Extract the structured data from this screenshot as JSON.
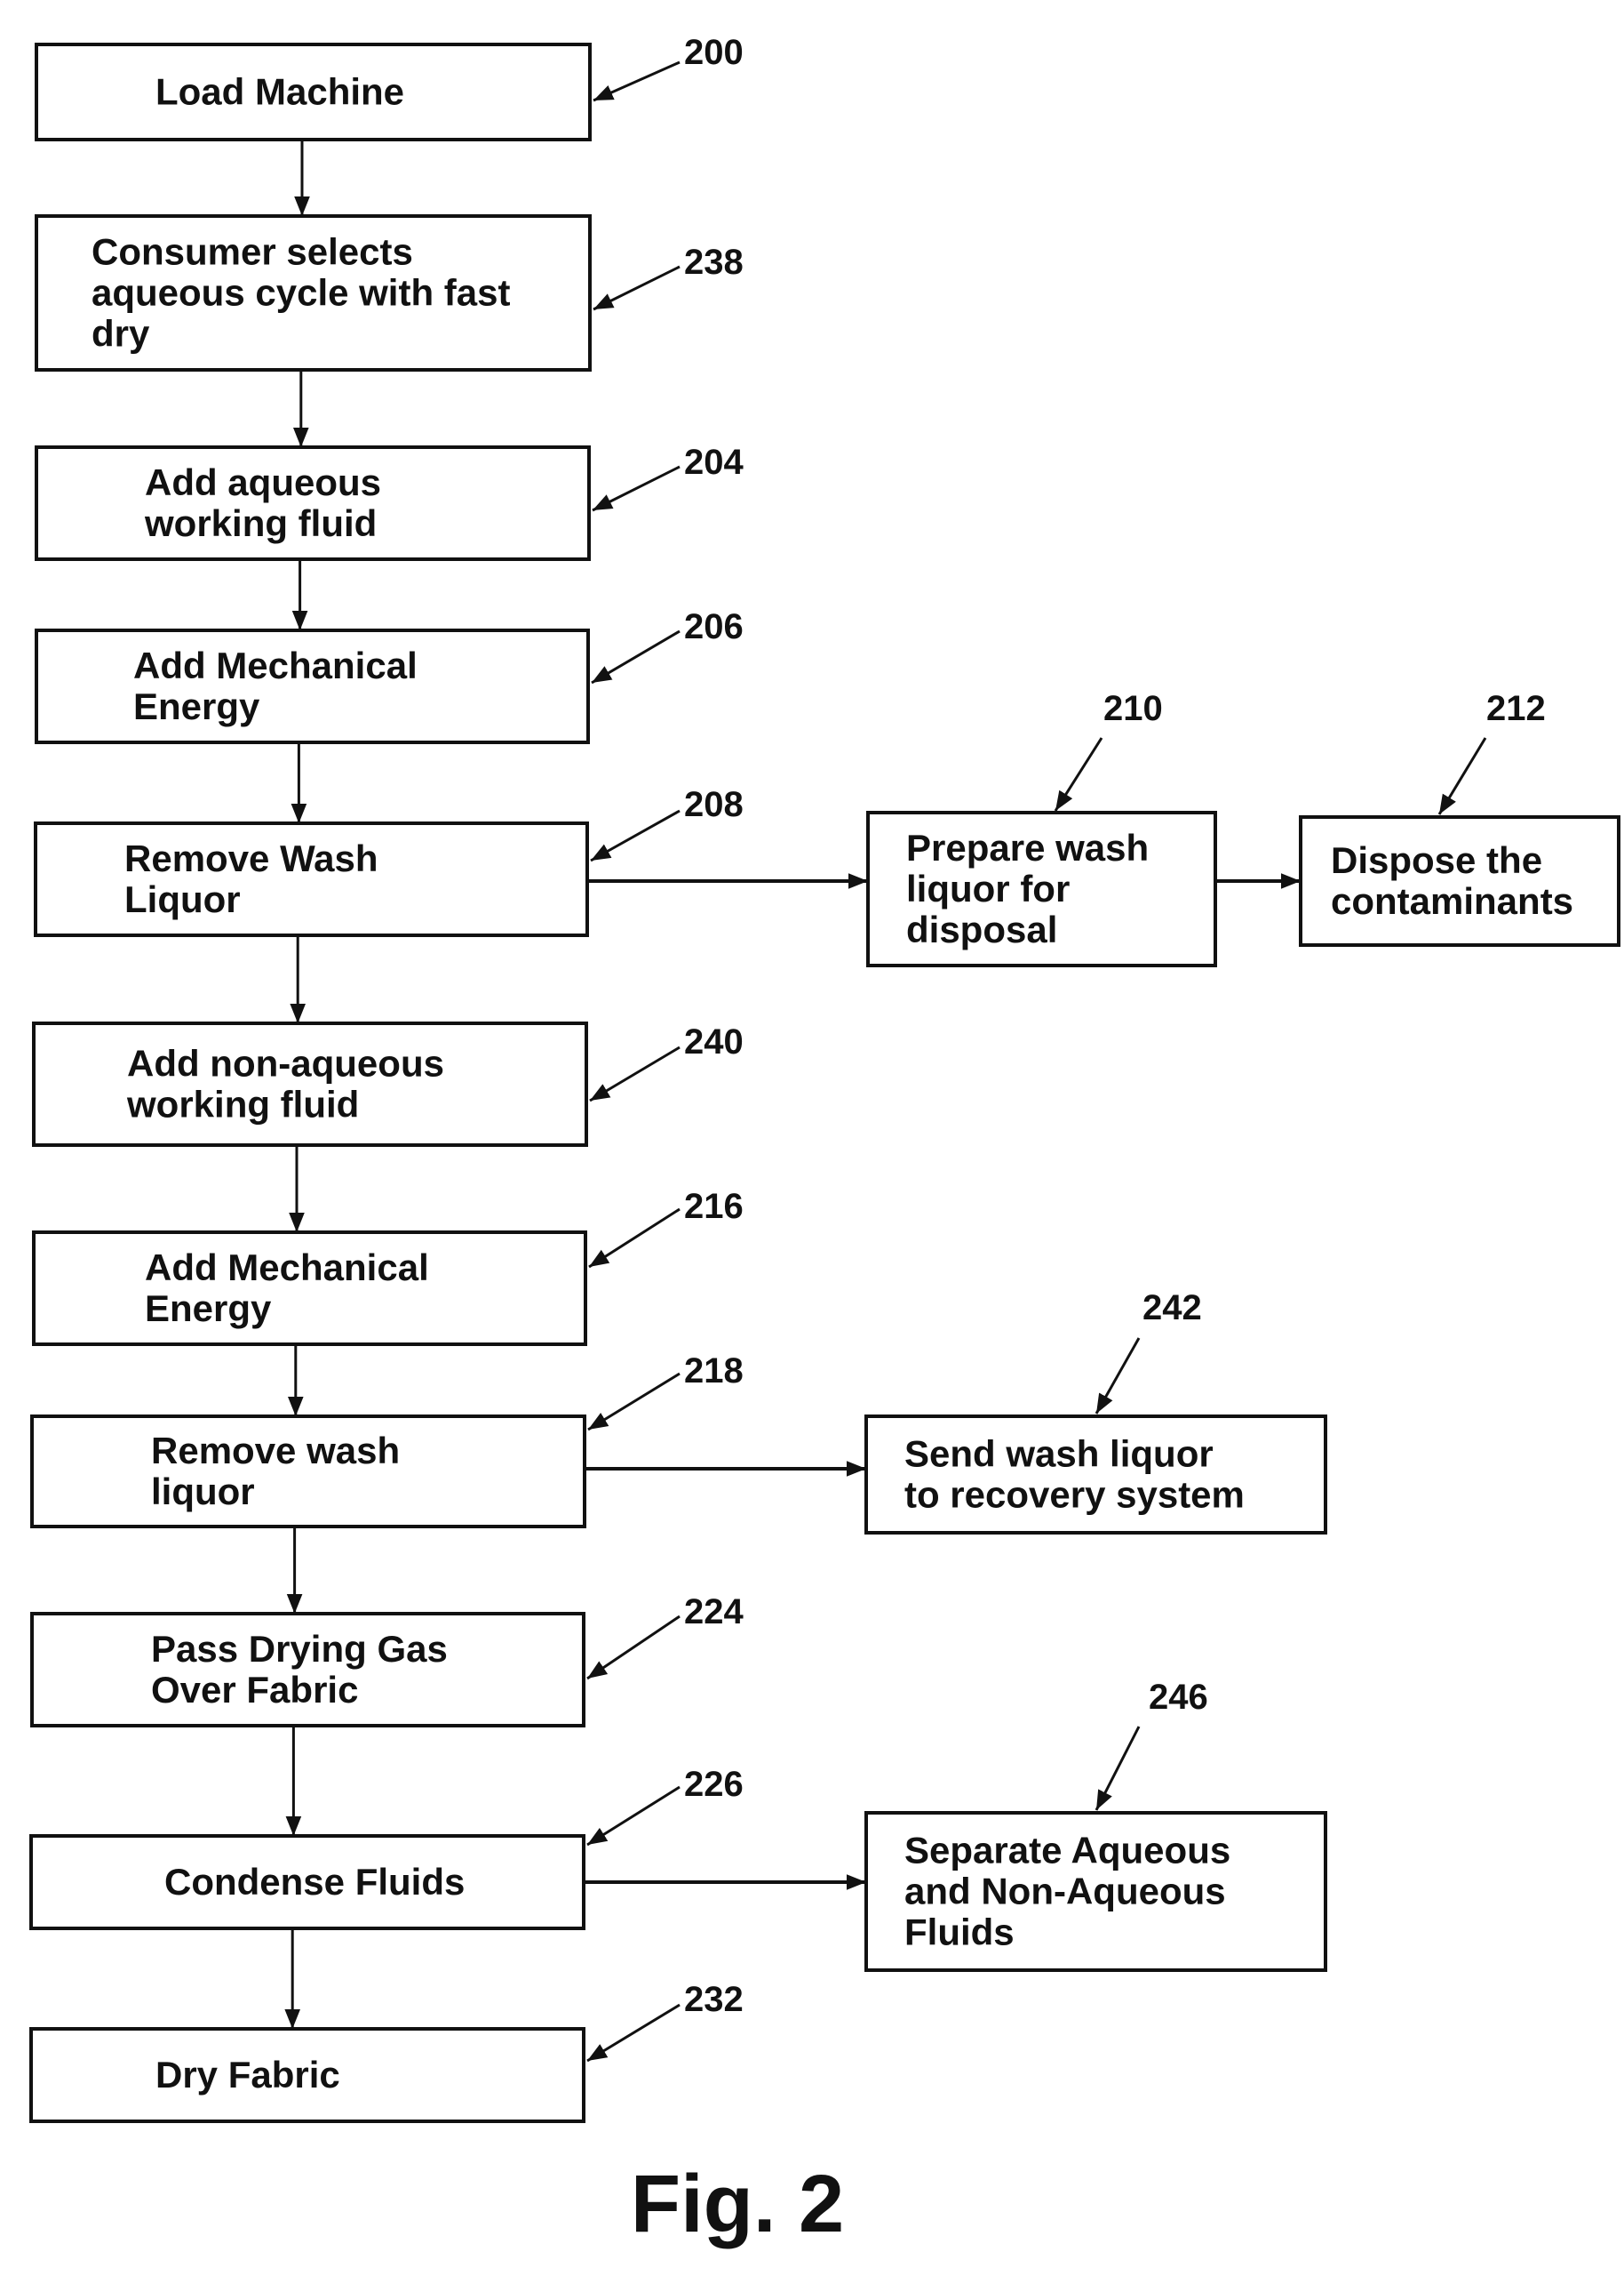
{
  "figure": {
    "caption": "Fig. 2",
    "steps": [
      {
        "id": "200",
        "lines": [
          "Load Machine"
        ]
      },
      {
        "id": "238",
        "lines": [
          "Consumer selects",
          "aqueous cycle with fast",
          "dry"
        ]
      },
      {
        "id": "204",
        "lines": [
          "Add aqueous",
          "working fluid"
        ]
      },
      {
        "id": "206",
        "lines": [
          "Add Mechanical",
          "Energy"
        ]
      },
      {
        "id": "208",
        "lines": [
          "Remove Wash",
          "Liquor"
        ]
      },
      {
        "id": "240",
        "lines": [
          "Add non-aqueous",
          "working fluid"
        ]
      },
      {
        "id": "216",
        "lines": [
          "Add Mechanical",
          "Energy"
        ]
      },
      {
        "id": "218",
        "lines": [
          "Remove wash",
          "liquor"
        ]
      },
      {
        "id": "224",
        "lines": [
          "Pass Drying Gas",
          "Over Fabric"
        ]
      },
      {
        "id": "226",
        "lines": [
          "Condense Fluids"
        ]
      },
      {
        "id": "232",
        "lines": [
          "Dry Fabric"
        ]
      }
    ],
    "branches": [
      {
        "id": "210",
        "from": "208",
        "lines": [
          "Prepare wash",
          "liquor for",
          "disposal"
        ]
      },
      {
        "id": "212",
        "from": "210",
        "lines": [
          "Dispose the",
          "contaminants"
        ]
      },
      {
        "id": "242",
        "from": "218",
        "lines": [
          "Send wash liquor",
          "to recovery system"
        ]
      },
      {
        "id": "246",
        "from": "226",
        "lines": [
          "Separate Aqueous",
          "and Non-Aqueous",
          "Fluids"
        ]
      }
    ]
  }
}
